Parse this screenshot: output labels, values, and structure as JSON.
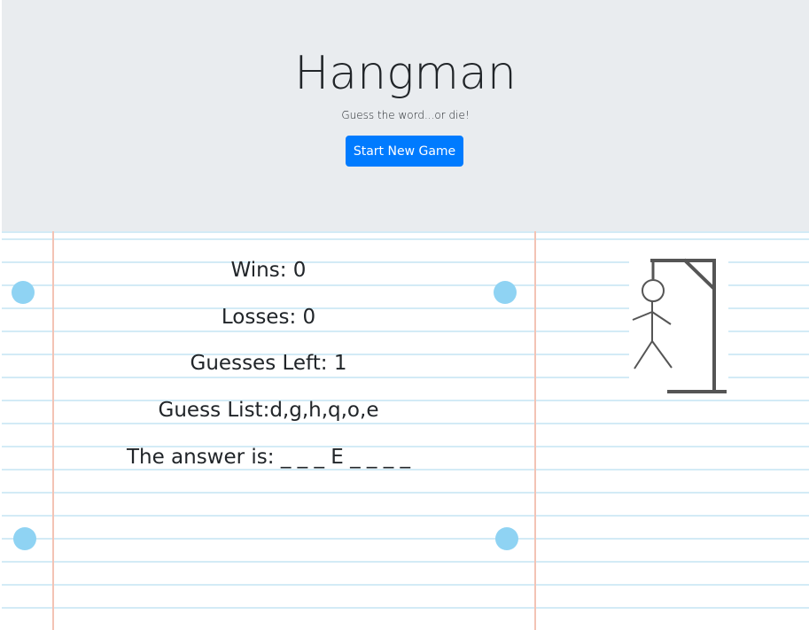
{
  "header": {
    "title": "Hangman",
    "subtitle": "Guess the word...or die!",
    "start_button_label": "Start New Game"
  },
  "stats": {
    "wins": "Wins: 0",
    "losses": "Losses: 0",
    "guesses_left": "Guesses Left: 1",
    "guess_list": "Guess List:d,g,h,q,o,e",
    "answer": "The answer is: _ _ _ E _ _ _ _"
  },
  "hangman_image": {
    "icon": "hangman-drawing-icon",
    "wrong_guesses": 5
  },
  "colors": {
    "jumbotron_bg": "#e9ecef",
    "button_primary": "#007bff",
    "notebook_line": "#d3ebf6",
    "margin_line": "#f3c3b5",
    "punch_hole": "#8fd3f3",
    "text": "#212529"
  }
}
